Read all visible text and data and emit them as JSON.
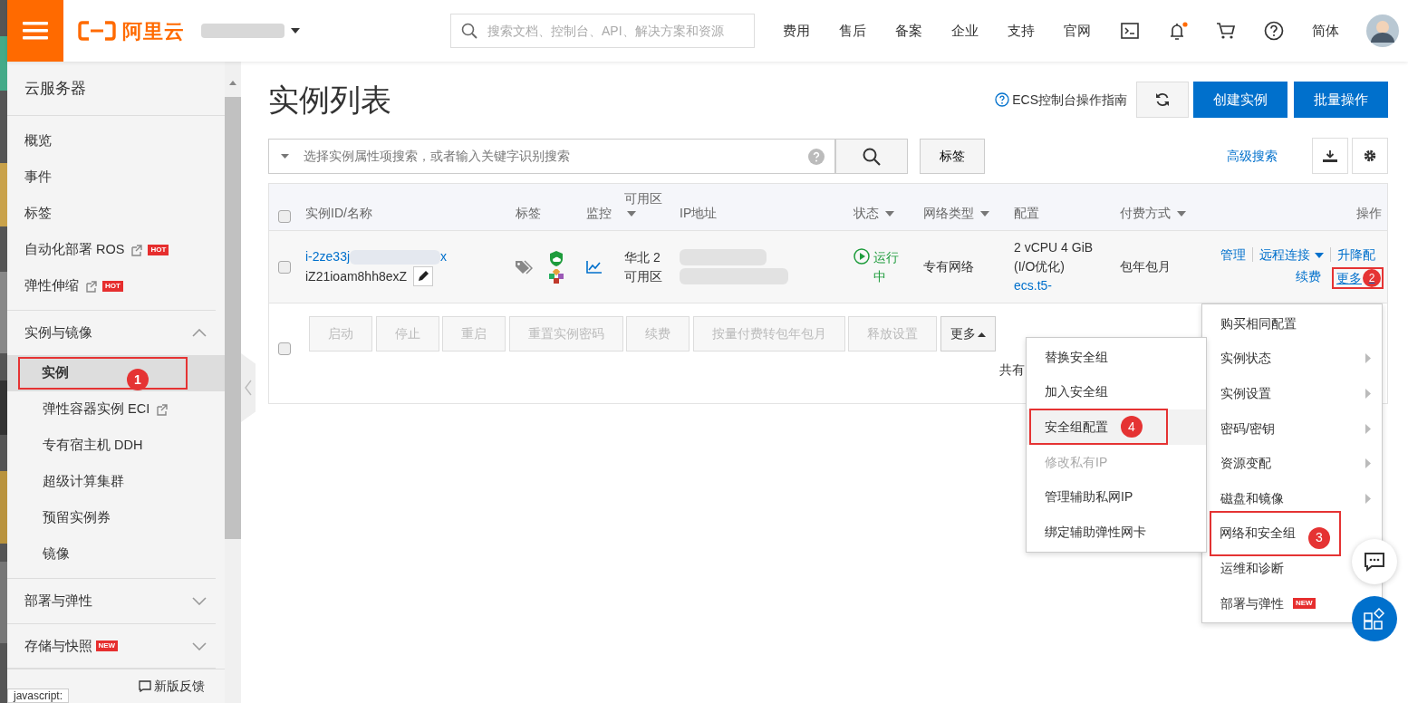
{
  "header": {
    "brand": "阿里云",
    "search_placeholder": "搜索文档、控制台、API、解决方案和资源",
    "nav": [
      "费用",
      "售后",
      "备案",
      "企业",
      "支持",
      "官网"
    ],
    "notification_dot": true,
    "language": "简体"
  },
  "sidebar": {
    "title": "云服务器",
    "items": [
      {
        "label": "概览",
        "selected": false
      },
      {
        "label": "事件",
        "selected": false
      },
      {
        "label": "标签",
        "selected": false
      },
      {
        "label": "自动化部署 ROS",
        "selected": false,
        "external": true,
        "badge": "HOT"
      },
      {
        "label": "弹性伸缩",
        "selected": false,
        "external": true,
        "badge": "HOT"
      }
    ],
    "groups": [
      {
        "label": "实例与镜像",
        "expanded": true,
        "children": [
          {
            "label": "实例",
            "selected": true,
            "callout": "1"
          },
          {
            "label": "弹性容器实例 ECI",
            "selected": false,
            "external": true
          },
          {
            "label": "专有宿主机 DDH",
            "selected": false
          },
          {
            "label": "超级计算集群",
            "selected": false
          },
          {
            "label": "预留实例券",
            "selected": false
          },
          {
            "label": "镜像",
            "selected": false
          }
        ]
      },
      {
        "label": "部署与弹性",
        "expanded": false
      },
      {
        "label": "存储与快照",
        "expanded": false,
        "badge": "NEW"
      }
    ],
    "footer_link": "新版反馈"
  },
  "page": {
    "title": "实例列表",
    "guide_link": "ECS控制台操作指南",
    "buttons": [
      "创建实例",
      "批量操作"
    ]
  },
  "filter": {
    "placeholder": "选择实例属性项搜索，或者输入关键字识别搜索",
    "tag_button": "标签",
    "advanced_search": "高级搜索"
  },
  "table": {
    "select_all_checked": false,
    "bulk_select_checked": false,
    "columns": [
      {
        "label": "实例ID/名称",
        "sortable": false
      },
      {
        "label": "标签",
        "sortable": false
      },
      {
        "label": "监控",
        "sortable": false
      },
      {
        "label": "可用区",
        "sortable": true
      },
      {
        "label": "IP地址",
        "sortable": false
      },
      {
        "label": "状态",
        "sortable": true
      },
      {
        "label": "网络类型",
        "sortable": true
      },
      {
        "label": "配置",
        "sortable": false
      },
      {
        "label": "付费方式",
        "sortable": true
      },
      {
        "label": "操作",
        "sortable": false
      }
    ],
    "rows": [
      {
        "checked": false,
        "id_start": "i-2ze33j",
        "id_end": "x",
        "name": "iZ21ioam8hh8exZ",
        "zone": "华北 2 可用区",
        "status": "运行中",
        "network": "专有网络",
        "config": [
          "2 vCPU 4 GiB",
          "(I/O优化)"
        ],
        "config_link": "ecs.t5-",
        "billing": "包年包月",
        "actions": [
          {
            "label": "管理"
          },
          {
            "label": "远程连接",
            "dropdown": true
          },
          {
            "label": "升降配"
          },
          {
            "label": "续费"
          },
          {
            "label": "更多",
            "callout": "2"
          }
        ]
      }
    ],
    "bulk_buttons": [
      {
        "label": "启动",
        "disabled": true
      },
      {
        "label": "停止",
        "disabled": true
      },
      {
        "label": "重启",
        "disabled": true
      },
      {
        "label": "重置实例密码",
        "disabled": true
      },
      {
        "label": "续费",
        "disabled": true
      },
      {
        "label": "按量付费转包年包月",
        "disabled": true
      },
      {
        "label": "释放设置",
        "disabled": true
      },
      {
        "label": "更多",
        "disabled": false
      }
    ],
    "total": "共有"
  },
  "more_menu": [
    {
      "label": "购买相同配置",
      "has_submenu": false
    },
    {
      "label": "实例状态",
      "has_submenu": true
    },
    {
      "label": "实例设置",
      "has_submenu": true
    },
    {
      "label": "密码/密钥",
      "has_submenu": true
    },
    {
      "label": "资源变配",
      "has_submenu": true
    },
    {
      "label": "磁盘和镜像",
      "has_submenu": true
    },
    {
      "label": "网络和安全组",
      "has_submenu": false,
      "callout": "3"
    },
    {
      "label": "运维和诊断"
    },
    {
      "label": "部署与弹性",
      "badge": "NEW"
    }
  ],
  "security_submenu": [
    {
      "label": "替换安全组",
      "selected": false,
      "disabled": false
    },
    {
      "label": "加入安全组",
      "selected": false,
      "disabled": false
    },
    {
      "label": "安全组配置",
      "selected": true,
      "disabled": false,
      "callout": "4"
    },
    {
      "label": "修改私有IP",
      "selected": false,
      "disabled": true
    },
    {
      "label": "管理辅助私网IP",
      "selected": false,
      "disabled": false
    },
    {
      "label": "绑定辅助弹性网卡",
      "selected": false,
      "disabled": false
    }
  ],
  "status_tooltip": "javascript:"
}
